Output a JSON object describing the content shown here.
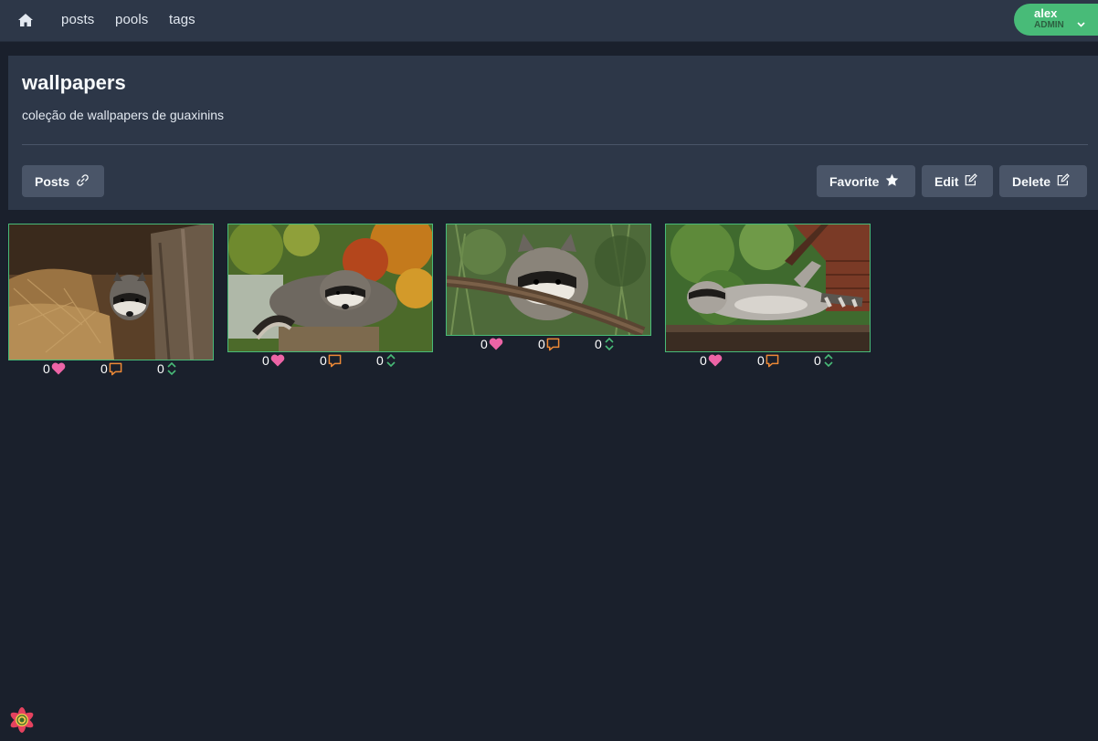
{
  "nav": {
    "links": [
      {
        "label": "posts"
      },
      {
        "label": "pools"
      },
      {
        "label": "tags"
      }
    ],
    "user": {
      "name": "alex",
      "role": "ADMIN"
    }
  },
  "pool": {
    "title": "wallpapers",
    "description": "coleção de wallpapers de guaxinins",
    "buttons": {
      "posts": "Posts",
      "favorite": "Favorite",
      "edit": "Edit",
      "delete": "Delete"
    }
  },
  "posts": [
    {
      "favorites": "0",
      "comments": "0",
      "score": "0"
    },
    {
      "favorites": "0",
      "comments": "0",
      "score": "0"
    },
    {
      "favorites": "0",
      "comments": "0",
      "score": "0"
    },
    {
      "favorites": "0",
      "comments": "0",
      "score": "0"
    }
  ],
  "icons": {
    "home": "home-icon",
    "link": "link-icon",
    "star": "star-icon",
    "edit": "edit-icon",
    "heart": "heart-icon",
    "comment": "comment-icon",
    "score": "vote-arrows-icon",
    "chevron": "chevron-down-icon"
  },
  "colors": {
    "background": "#1a202c",
    "panel": "#2d3748",
    "button": "#4a5568",
    "accent_green": "#48bb78",
    "heart": "#ed64a6",
    "comment": "#ed8936",
    "score": "#48bb78"
  }
}
